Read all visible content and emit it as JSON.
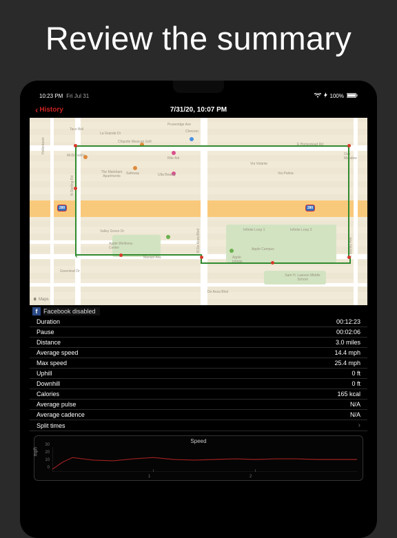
{
  "promo": {
    "title": "Review the summary"
  },
  "status": {
    "time": "10:23 PM",
    "date": "Fri Jul 31",
    "battery": "100%"
  },
  "nav": {
    "back": "History",
    "title": "7/31/20, 10:07 PM"
  },
  "map": {
    "attribution": "Maps",
    "poi": {
      "chevron": "Chevron",
      "chipotle": "Chipotle Mexican Grill",
      "riteaid": "Rite Aid",
      "mcd": "McDonald's",
      "markham": "The Markham Apartments",
      "safeway": "Safeway",
      "ulta": "Ulta Beauty",
      "tacobell": "Taco Bell",
      "lagrande": "La Grande Dr",
      "homestead": "E Homestead Rd",
      "stelling": "N Stelling Rd",
      "hollenbeck": "Hollenbeck",
      "mariani": "Mariani Ave",
      "greenleaf": "Greenleaf Dr",
      "deanzaN": "N De Anza Blvd",
      "deanzaS": "De Anza Blvd",
      "applewellness": "Apple Wellness Center",
      "applepark": "Apple Campus",
      "infinite": "Infinite Loop 1",
      "infinite3": "Infinite Loop 3",
      "apple2": "Apple Infinite",
      "lawson": "Sam H. Lawson Middle School",
      "valleygreen": "Valley Green Dr",
      "viavolante": "Via Volante",
      "viapalma": "Via Palma",
      "oakmeadow": "Oak Meadow",
      "bianchi": "S Blaney Ave",
      "pruneridge": "Pruneridge Ave"
    },
    "shields": {
      "hwy1": "280",
      "hwy2": "280"
    }
  },
  "facebook": {
    "label": "Facebook disabled"
  },
  "stats": [
    {
      "label": "Duration",
      "value": "00:12:23"
    },
    {
      "label": "Pause",
      "value": "00:02:06"
    },
    {
      "label": "Distance",
      "value": "3.0 miles"
    },
    {
      "label": "Average speed",
      "value": "14.4 mph"
    },
    {
      "label": "Max speed",
      "value": "25.4 mph"
    },
    {
      "label": "Uphill",
      "value": "0 ft"
    },
    {
      "label": "Downhill",
      "value": "0 ft"
    },
    {
      "label": "Calories",
      "value": "165 kcal"
    },
    {
      "label": "Average pulse",
      "value": "N/A"
    },
    {
      "label": "Average cadence",
      "value": "N/A"
    }
  ],
  "split": {
    "label": "Split times"
  },
  "chart_data": {
    "type": "line",
    "title": "Speed",
    "ylabel": "mph",
    "ylim": [
      0,
      30
    ],
    "yticks": [
      0,
      10,
      20,
      30
    ],
    "x": [
      0,
      0.1,
      0.2,
      0.4,
      0.6,
      0.8,
      1.0,
      1.2,
      1.4,
      1.6,
      1.8,
      2.0,
      2.2,
      2.4,
      2.6,
      2.8,
      3.0
    ],
    "values": [
      3,
      12,
      17,
      14,
      13,
      16,
      17,
      15,
      14,
      15,
      16,
      15,
      16,
      16,
      15,
      15,
      15
    ],
    "xticks": [
      1,
      2
    ]
  }
}
